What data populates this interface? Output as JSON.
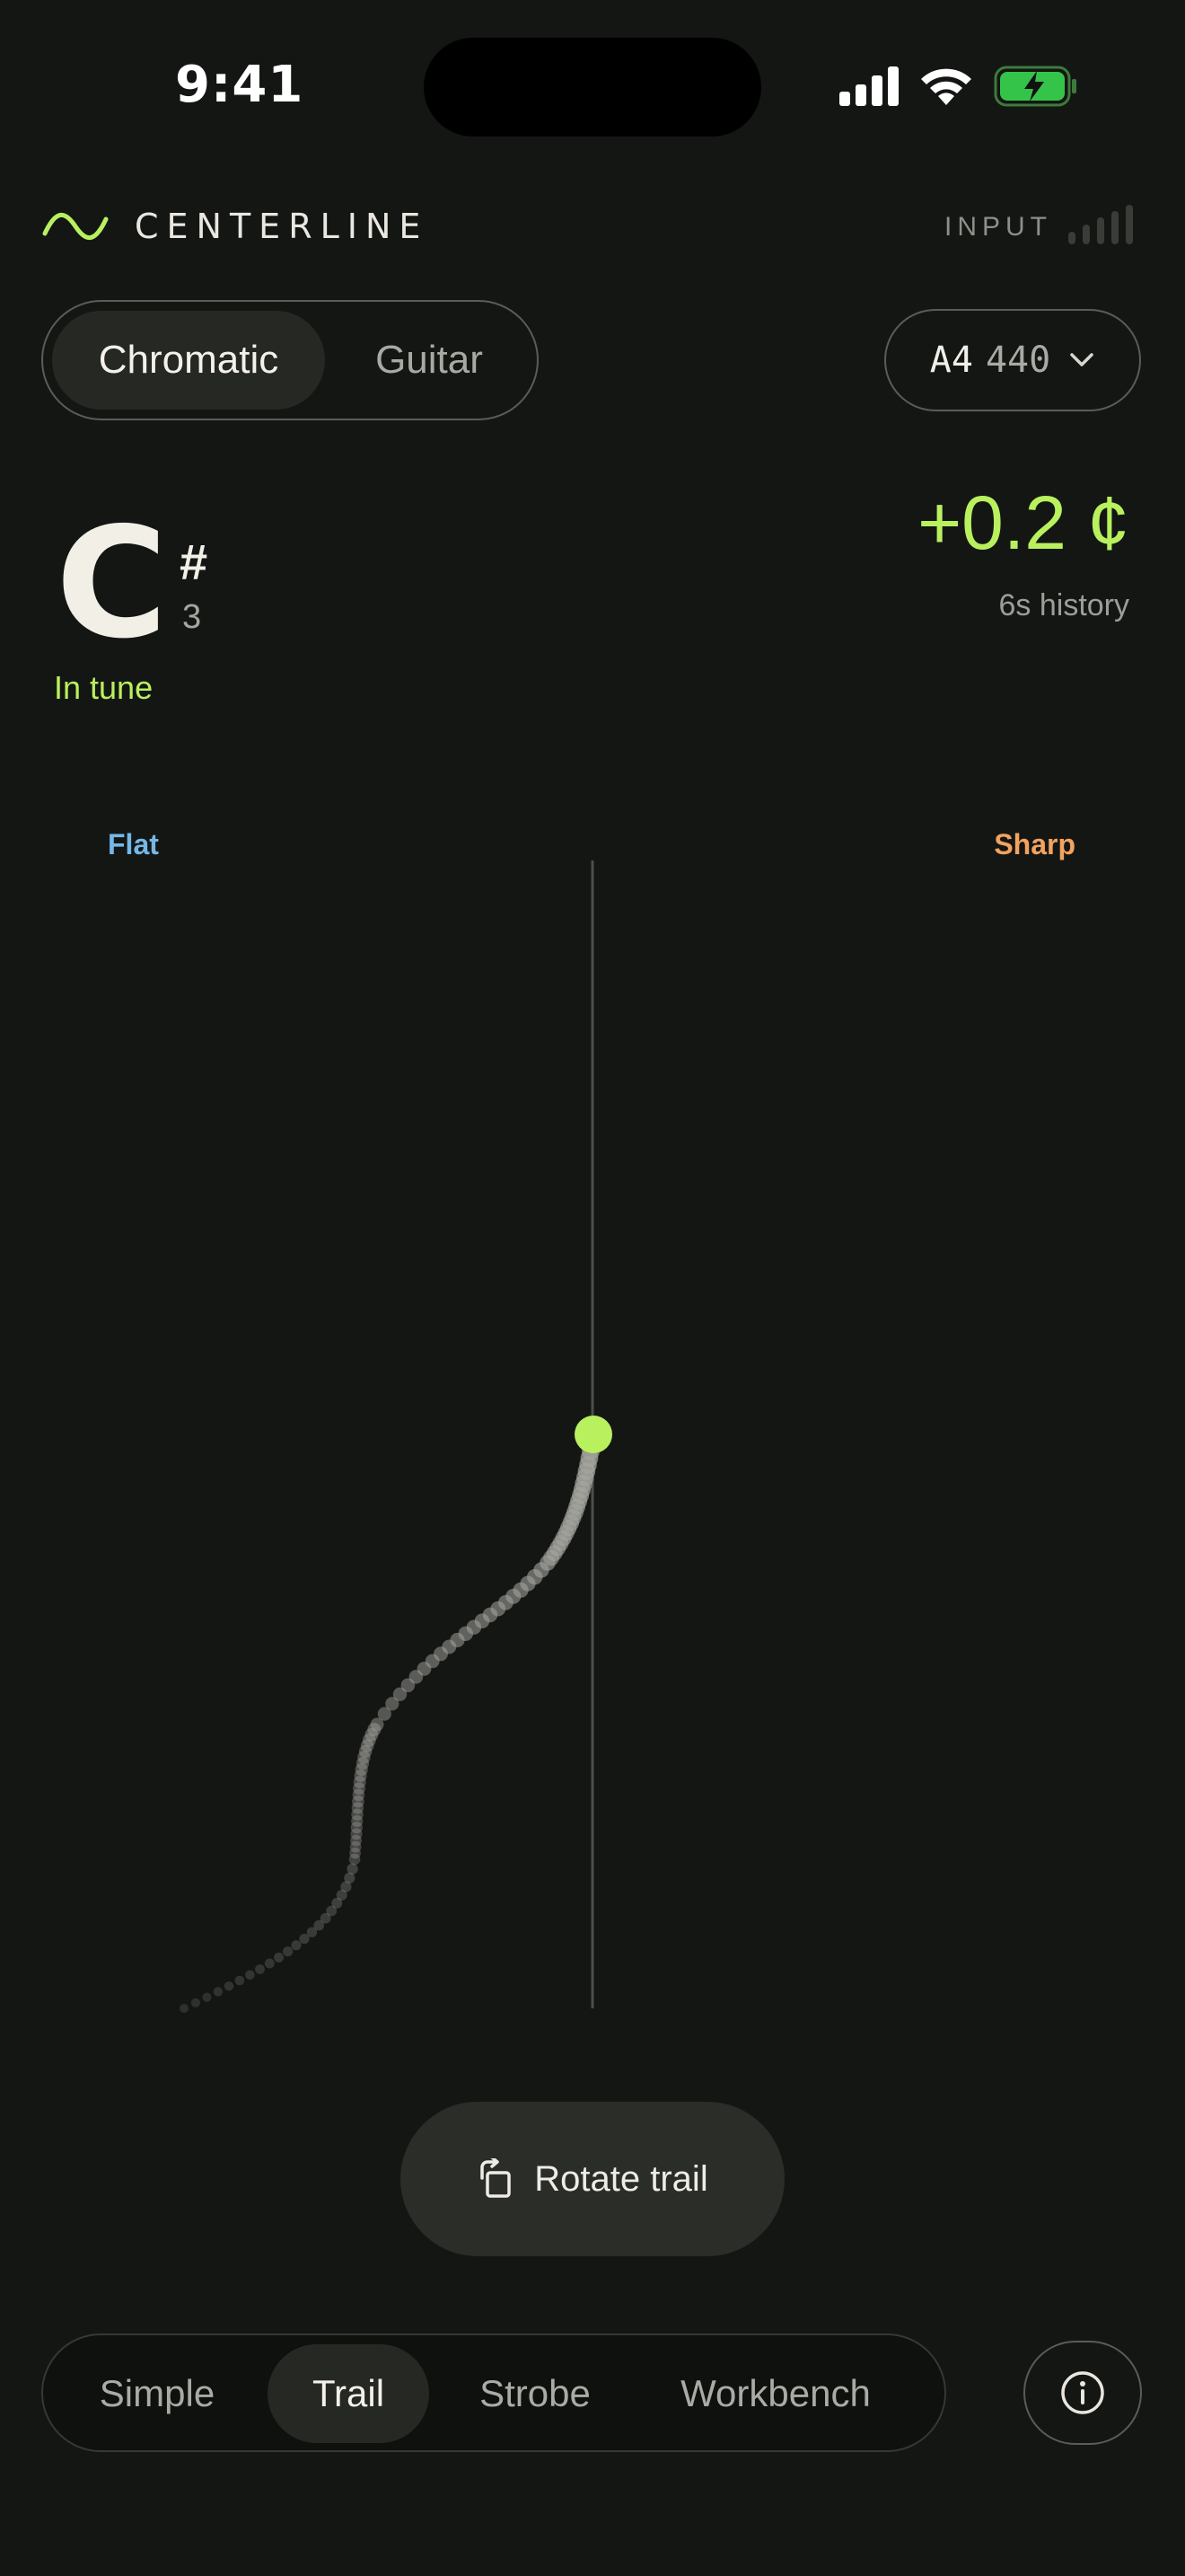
{
  "status_bar": {
    "time": "9:41"
  },
  "header": {
    "brand": "CENTERLINE",
    "input_label": "INPUT"
  },
  "mode": {
    "options": [
      "Chromatic",
      "Guitar"
    ],
    "selected": "Chromatic"
  },
  "reference": {
    "note": "A4",
    "frequency": "440"
  },
  "tuner": {
    "note": "C",
    "accidental": "#",
    "octave": "3",
    "status": "In tune",
    "cents": "+0.2 ¢",
    "history": "6s history",
    "flat_label": "Flat",
    "sharp_label": "Sharp"
  },
  "actions": {
    "rotate_label": "Rotate trail"
  },
  "views": {
    "tabs": [
      "Simple",
      "Trail",
      "Strobe",
      "Workbench"
    ],
    "selected": "Trail"
  },
  "colors": {
    "accent": "#b9f05e",
    "flat": "#74b8e8",
    "sharp": "#f2a35e",
    "background": "#141614"
  },
  "icons": [
    "wave-icon",
    "input-meter-icon",
    "chevron-down-icon",
    "rotate-icon",
    "info-icon",
    "signal-icon",
    "wifi-icon",
    "battery-icon"
  ]
}
